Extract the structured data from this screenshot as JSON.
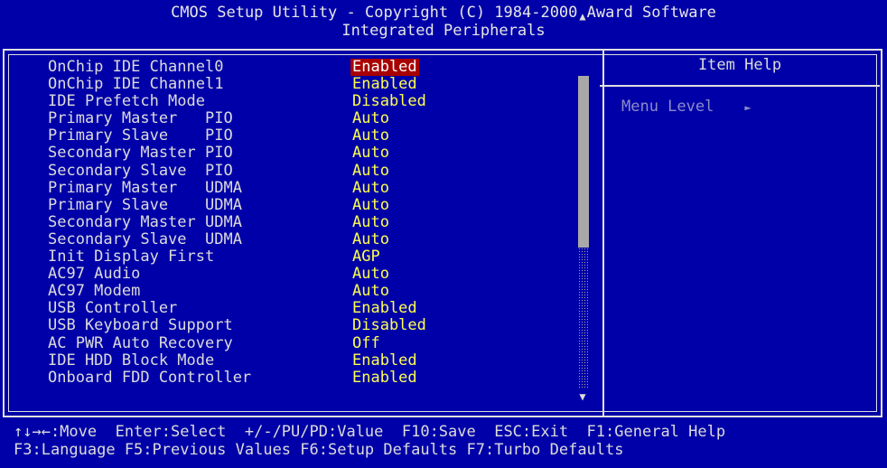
{
  "header": {
    "line1": "CMOS Setup Utility - Copyright (C) 1984-2000 Award Software",
    "line2": "Integrated Peripherals"
  },
  "settings": [
    {
      "label": "OnChip IDE Channel0",
      "value": "Enabled",
      "selected": true
    },
    {
      "label": "OnChip IDE Channel1",
      "value": "Enabled"
    },
    {
      "label": "IDE Prefetch Mode",
      "value": "Disabled"
    },
    {
      "label": "Primary Master   PIO",
      "value": "Auto"
    },
    {
      "label": "Primary Slave    PIO",
      "value": "Auto"
    },
    {
      "label": "Secondary Master PIO",
      "value": "Auto"
    },
    {
      "label": "Secondary Slave  PIO",
      "value": "Auto"
    },
    {
      "label": "Primary Master   UDMA",
      "value": "Auto"
    },
    {
      "label": "Primary Slave    UDMA",
      "value": "Auto"
    },
    {
      "label": "Secondary Master UDMA",
      "value": "Auto"
    },
    {
      "label": "Secondary Slave  UDMA",
      "value": "Auto"
    },
    {
      "label": "Init Display First",
      "value": "AGP"
    },
    {
      "label": "AC97 Audio",
      "value": "Auto"
    },
    {
      "label": "AC97 Modem",
      "value": "Auto"
    },
    {
      "label": "USB Controller",
      "value": "Enabled"
    },
    {
      "label": "USB Keyboard Support",
      "value": "Disabled"
    },
    {
      "label": "AC PWR Auto Recovery",
      "value": "Off"
    },
    {
      "label": "IDE HDD Block Mode",
      "value": "Enabled"
    },
    {
      "label": "Onboard FDD Controller",
      "value": "Enabled"
    }
  ],
  "help": {
    "title": "Item Help",
    "menu_level": "Menu Level"
  },
  "footer": {
    "line1": "↑↓→←:Move  Enter:Select  +/-/PU/PD:Value  F10:Save  ESC:Exit  F1:General Help",
    "line2": "F3:Language F5:Previous Values F6:Setup Defaults F7:Turbo Defaults"
  },
  "colors": {
    "background": "#0000a8",
    "value_text": "#ffff50",
    "selected_bg": "#a80000"
  }
}
